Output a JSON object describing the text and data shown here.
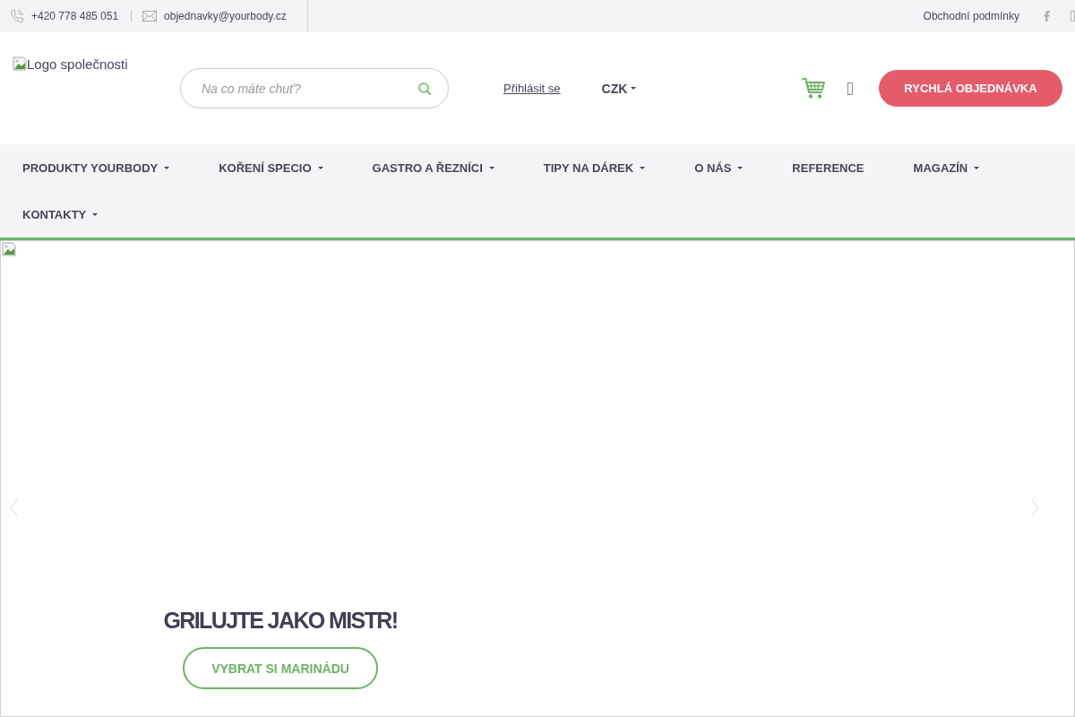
{
  "top_bar": {
    "phone": "+420 778 485 051",
    "email": "objednavky@yourbody.cz",
    "terms_link": "Obchodní podmínky"
  },
  "header": {
    "logo_alt": "Logo společnosti",
    "search": {
      "placeholder": "Na co máte chuť?"
    },
    "login_link": "Přihlásit se",
    "currency": "CZK",
    "quick_order_button": "RYCHLÁ OBJEDNÁVKA"
  },
  "nav": {
    "items": [
      {
        "label": "PRODUKTY YOURBODY",
        "dropdown": true
      },
      {
        "label": "KOŘENÍ SPECIO",
        "dropdown": true
      },
      {
        "label": "GASTRO A ŘEZNÍCI",
        "dropdown": true
      },
      {
        "label": "TIPY NA DÁREK",
        "dropdown": true
      },
      {
        "label": "O NÁS",
        "dropdown": true
      },
      {
        "label": "REFERENCE",
        "dropdown": false
      },
      {
        "label": "MAGAZÍN",
        "dropdown": true
      },
      {
        "label": "KONTAKTY",
        "dropdown": true
      }
    ]
  },
  "hero": {
    "title": "GRILUJTE JAKO MISTR!",
    "button": "VYBRAT SI MARINÁDU"
  }
}
